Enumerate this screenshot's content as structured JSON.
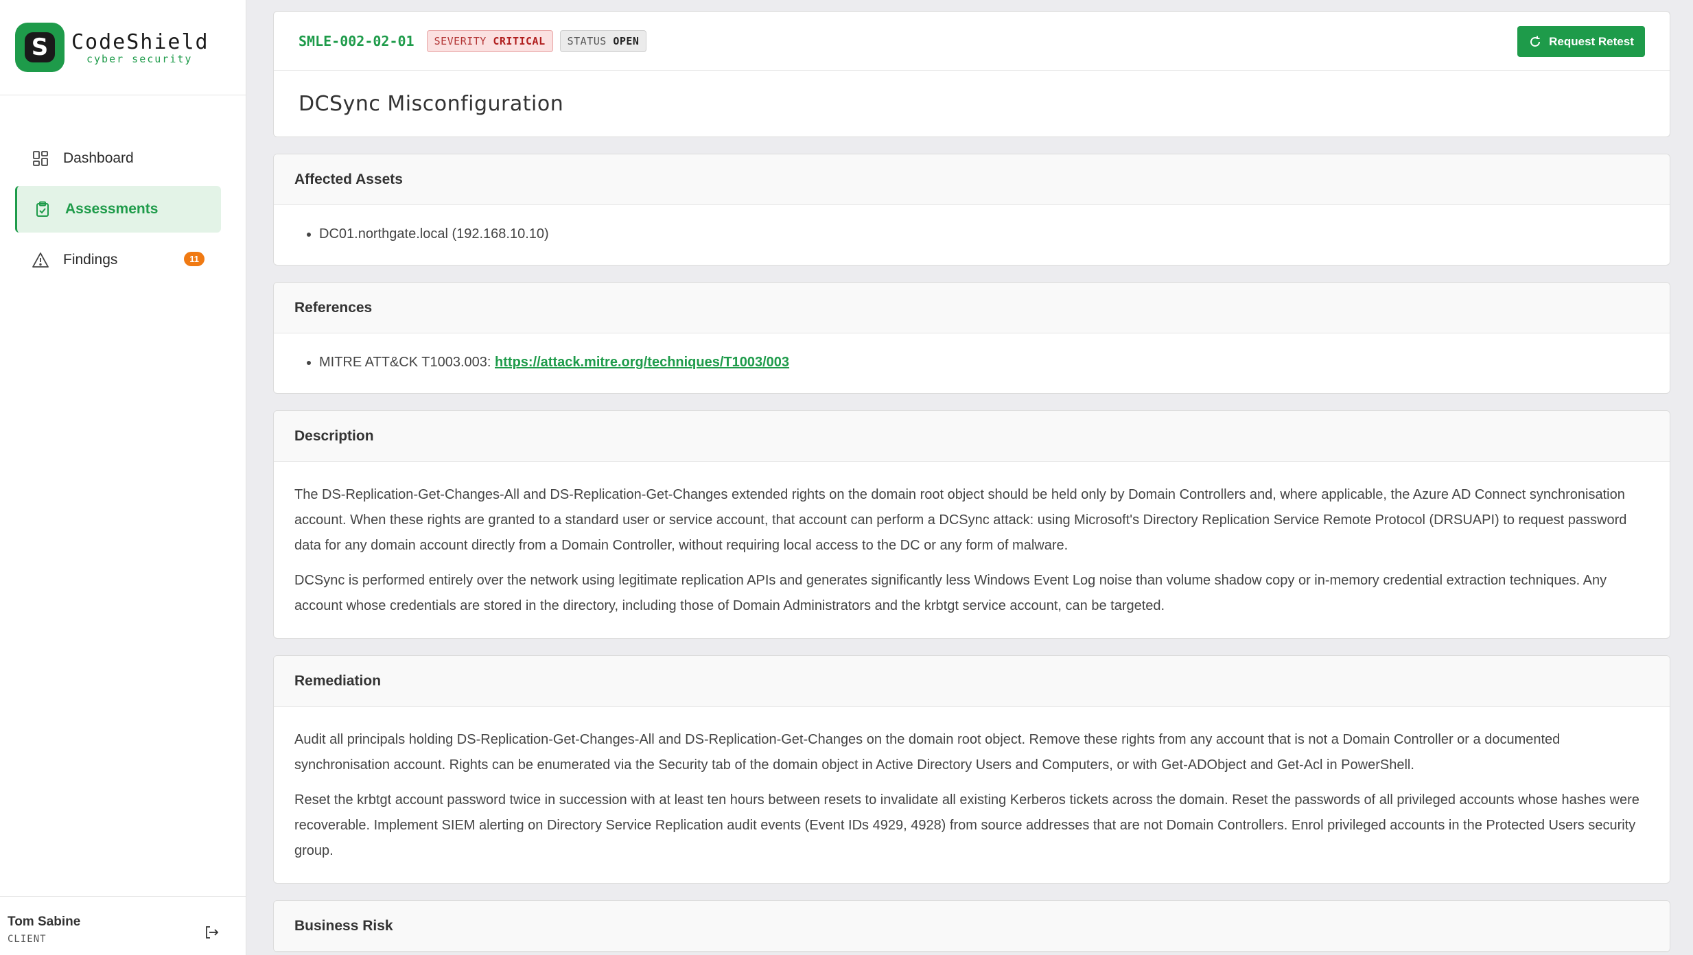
{
  "brand": {
    "name": "CodeShield",
    "tagline": "cyber security",
    "mark_letter": "S",
    "accent": "#1e9b4a"
  },
  "nav": {
    "items": [
      {
        "label": "Dashboard",
        "icon": "dashboard-grid-icon"
      },
      {
        "label": "Assessments",
        "icon": "clipboard-check-icon",
        "active": true
      },
      {
        "label": "Findings",
        "icon": "warning-triangle-icon",
        "badge": "11"
      }
    ]
  },
  "user": {
    "name": "Tom Sabine",
    "role": "CLIENT"
  },
  "finding": {
    "id": "SMLE-002-02-01",
    "severity_label": "SEVERITY",
    "severity_value": "CRITICAL",
    "status_label": "STATUS",
    "status_value": "OPEN",
    "retest_label": "Request Retest",
    "title": "DCSync Misconfiguration"
  },
  "affected_assets": {
    "heading": "Affected Assets",
    "items": [
      "DC01.northgate.local (192.168.10.10)"
    ]
  },
  "references": {
    "heading": "References",
    "items": [
      {
        "prefix": "MITRE ATT&CK T1003.003: ",
        "link": "https://attack.mitre.org/techniques/T1003/003"
      }
    ]
  },
  "description": {
    "heading": "Description",
    "paragraphs": [
      "The DS-Replication-Get-Changes-All and DS-Replication-Get-Changes extended rights on the domain root object should be held only by Domain Controllers and, where applicable, the Azure AD Connect synchronisation account. When these rights are granted to a standard user or service account, that account can perform a DCSync attack: using Microsoft's Directory Replication Service Remote Protocol (DRSUAPI) to request password data for any domain account directly from a Domain Controller, without requiring local access to the DC or any form of malware.",
      "DCSync is performed entirely over the network using legitimate replication APIs and generates significantly less Windows Event Log noise than volume shadow copy or in-memory credential extraction techniques. Any account whose credentials are stored in the directory, including those of Domain Administrators and the krbtgt service account, can be targeted."
    ]
  },
  "remediation": {
    "heading": "Remediation",
    "paragraphs": [
      "Audit all principals holding DS-Replication-Get-Changes-All and DS-Replication-Get-Changes on the domain root object. Remove these rights from any account that is not a Domain Controller or a documented synchronisation account. Rights can be enumerated via the Security tab of the domain object in Active Directory Users and Computers, or with Get-ADObject and Get-Acl in PowerShell.",
      "Reset the krbtgt account password twice in succession with at least ten hours between resets to invalidate all existing Kerberos tickets across the domain. Reset the passwords of all privileged accounts whose hashes were recoverable. Implement SIEM alerting on Directory Service Replication audit events (Event IDs 4929, 4928) from source addresses that are not Domain Controllers. Enrol privileged accounts in the Protected Users security group."
    ]
  },
  "business_risk": {
    "heading": "Business Risk"
  }
}
